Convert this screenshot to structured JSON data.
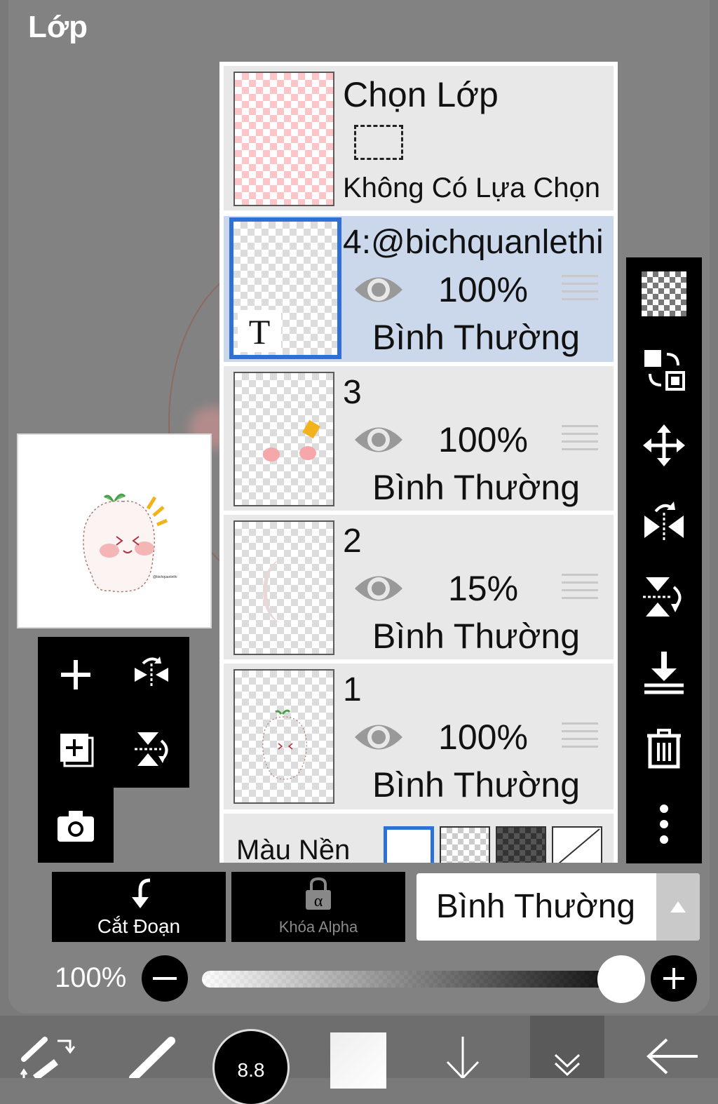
{
  "panel": {
    "title": "Lớp"
  },
  "selection": {
    "title": "Chọn Lớp",
    "status": "Không Có Lựa Chọn"
  },
  "layers": [
    {
      "name": "4:@bichquanlethi",
      "opacity": "100%",
      "blend": "Bình Thường",
      "selected": true,
      "type": "text",
      "thumb_label": "T"
    },
    {
      "name": "3",
      "opacity": "100%",
      "blend": "Bình Thường",
      "selected": false
    },
    {
      "name": "2",
      "opacity": "15%",
      "blend": "Bình Thường",
      "selected": false
    },
    {
      "name": "1",
      "opacity": "100%",
      "blend": "Bình Thường",
      "selected": false
    }
  ],
  "background": {
    "label": "Màu Nền"
  },
  "bottom": {
    "clip_label": "Cắt Đoạn",
    "alpha_lock_label": "Khóa Alpha",
    "blend_mode": "Bình Thường",
    "opacity": "100%",
    "opacity_level": 1.0,
    "brush_size_label": "8.8"
  },
  "colors": {
    "selected_row": "#cbd8ec",
    "selected_border": "#2f6fd8",
    "toolbar": "#000000"
  },
  "icons": {
    "left_tools": [
      "plus-icon",
      "flip-horizontal-icon",
      "add-copy-icon",
      "flip-vertical-icon",
      "camera-icon"
    ],
    "right_tools": [
      "transparency-icon",
      "swap-layers-icon",
      "move-icon",
      "flip-h-icon",
      "flip-v-icon",
      "merge-down-icon",
      "trash-icon",
      "more-icon"
    ],
    "bottom_nav": [
      "tools-icon",
      "brush-icon",
      "brush-size-icon",
      "color-icon",
      "down-arrow-icon",
      "layers-icon",
      "back-icon"
    ]
  }
}
